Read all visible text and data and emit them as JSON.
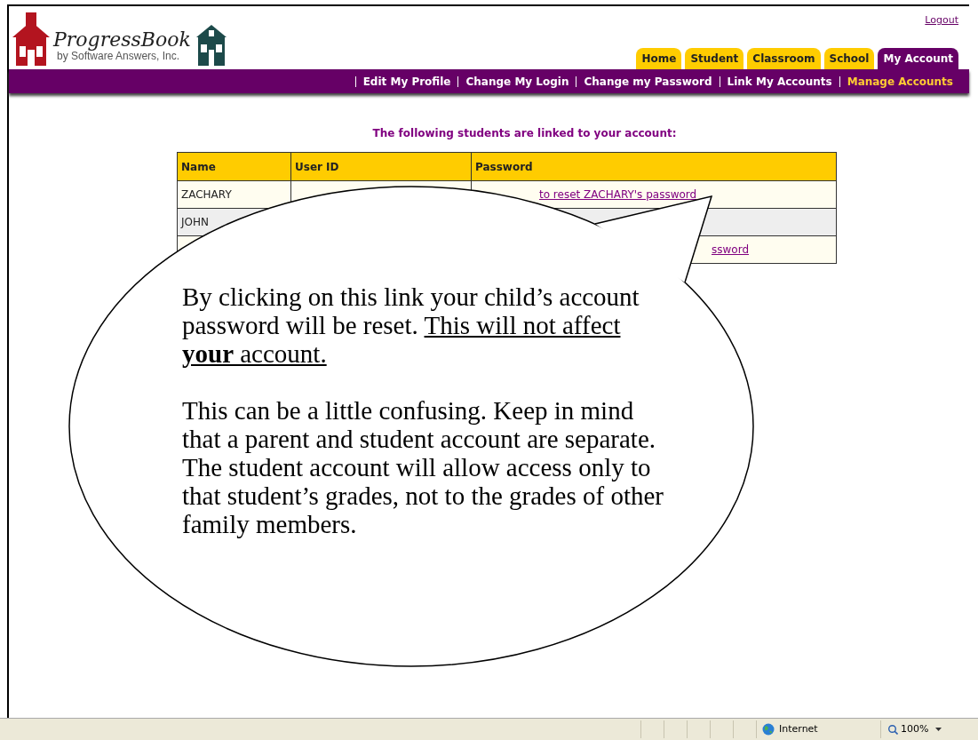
{
  "header": {
    "logo": {
      "title": "ProgressBook",
      "subtitle": "by Software Answers, Inc."
    },
    "logout": "Logout"
  },
  "tabs": [
    {
      "label": "Home",
      "selected": false
    },
    {
      "label": "Student",
      "selected": false
    },
    {
      "label": "Classroom",
      "selected": false
    },
    {
      "label": "School",
      "selected": false
    },
    {
      "label": "My Account",
      "selected": true
    }
  ],
  "subnav": [
    {
      "label": "Edit My Profile",
      "selected": false
    },
    {
      "label": "Change My Login",
      "selected": false
    },
    {
      "label": "Change my Password",
      "selected": false
    },
    {
      "label": "Link My Accounts",
      "selected": false
    },
    {
      "label": "Manage Accounts",
      "selected": true
    }
  ],
  "caption": "The following students are linked to your account:",
  "table": {
    "columns": [
      "Name",
      "User ID",
      "Password"
    ],
    "rows": [
      {
        "name": "ZACHARY",
        "password_link": "to reset ZACHARY's password"
      },
      {
        "name": "JOHN"
      },
      {
        "password_link": "ssword"
      }
    ]
  },
  "callout": {
    "paragraphs": [
      {
        "text": "By clicking on this link your child’s account password will be reset.",
        "underlined": "This will not affect **your** account."
      },
      {
        "text": "This can be a little confusing.  Keep in mind that a parent and student account are separate. The student account will allow access only to that student’s grades, not to the grades of other family members."
      }
    ]
  },
  "status_bar": {
    "zone": "Internet",
    "zoom": "100%"
  }
}
